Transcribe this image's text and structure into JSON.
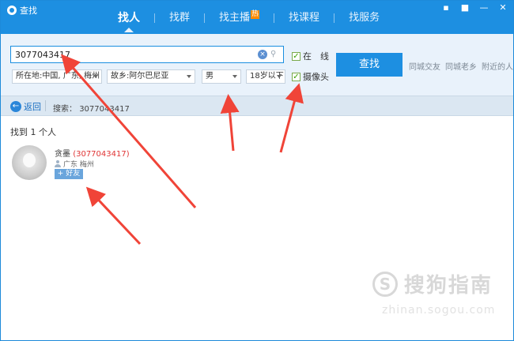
{
  "window": {
    "title": "查找",
    "controls": [
      "▪",
      "■",
      "—",
      "✕"
    ]
  },
  "tabs": [
    {
      "label": "找人",
      "active": true
    },
    {
      "label": "找群",
      "active": false
    },
    {
      "label": "找主播",
      "badge": "热",
      "active": false
    },
    {
      "label": "找课程",
      "active": false
    },
    {
      "label": "找服务",
      "active": false
    }
  ],
  "search": {
    "value": "3077043417",
    "online_label": "在　线",
    "camera_label": "摄像头",
    "online_checked": true,
    "camera_checked": true,
    "find_button": "查找",
    "quick_links": [
      "同城交友",
      "同城老乡",
      "附近的人"
    ]
  },
  "filters": {
    "location": "所在地:中国, 广东, 梅州",
    "hometown": "故乡:阿尔巴尼亚",
    "gender": "男",
    "age": "18岁以下"
  },
  "backbar": {
    "back_label": "返回",
    "search_prefix": "搜索：",
    "search_value": "3077043417"
  },
  "results": {
    "count_text": "找到 1 个人",
    "items": [
      {
        "nickname": "贪墨",
        "id": "(3077043417)",
        "location": "广东 梅州",
        "add_label": "+ 好友"
      }
    ]
  },
  "watermark": {
    "logo_char": "S",
    "text": "搜狗指南",
    "url": "zhinan.sogou.com"
  },
  "colors": {
    "accent": "#1d8fe1",
    "arrow": "#f04438",
    "id_text": "#e03535"
  }
}
